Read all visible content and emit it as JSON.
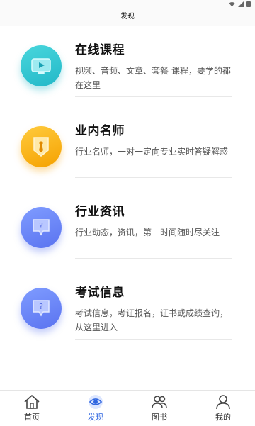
{
  "status_bar": {
    "icons": [
      "wifi-icon",
      "signal-icon",
      "battery-icon"
    ]
  },
  "header": {
    "title": "发现"
  },
  "items": [
    {
      "title": "在线课程",
      "description": "视频、音频、文章、套餐 课程，要学的都在这里",
      "icon": "video-play-icon",
      "color": "#2bc0cf"
    },
    {
      "title": "业内名师",
      "description": "行业名师，一对一定向专业实时答疑解惑",
      "icon": "teacher-tie-icon",
      "color": "#f7a900"
    },
    {
      "title": "行业资讯",
      "description": "行业动态，资讯，第一时间随时尽关注",
      "icon": "question-bubble-icon",
      "color": "#6680f5"
    },
    {
      "title": "考试信息",
      "description": "考试信息，考证报名，证书或成绩查询，从这里进入",
      "icon": "question-bubble-icon",
      "color": "#6680f5"
    }
  ],
  "tab_bar": {
    "active_color": "#2f66e0",
    "tabs": [
      {
        "label": "首页",
        "icon": "home-icon",
        "active": false
      },
      {
        "label": "发现",
        "icon": "eye-icon",
        "active": true
      },
      {
        "label": "图书",
        "icon": "users-icon",
        "active": false
      },
      {
        "label": "我的",
        "icon": "person-icon",
        "active": false
      }
    ]
  }
}
